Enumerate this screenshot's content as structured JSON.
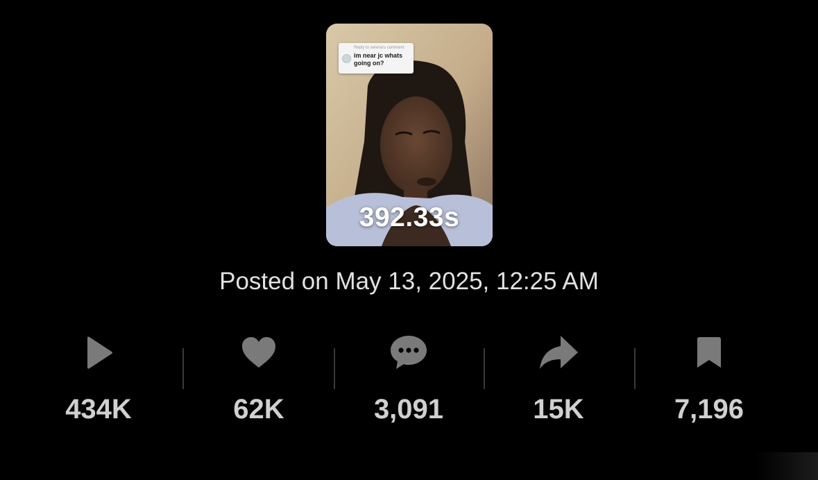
{
  "video": {
    "duration": "392.33s",
    "comment_reply": "Reply to serena's comment",
    "comment_text": "im near jc whats going on?"
  },
  "posted": "Posted on May 13, 2025, 12:25 AM",
  "stats": [
    {
      "icon": "play-icon",
      "value": "434K"
    },
    {
      "icon": "heart-icon",
      "value": "62K"
    },
    {
      "icon": "comment-icon",
      "value": "3,091"
    },
    {
      "icon": "share-icon",
      "value": "15K"
    },
    {
      "icon": "bookmark-icon",
      "value": "7,196"
    }
  ],
  "colors": {
    "background": "#000000",
    "icon": "#7a7a7a",
    "value_text": "#d0d0d0",
    "posted_text": "#e2e2e2"
  }
}
